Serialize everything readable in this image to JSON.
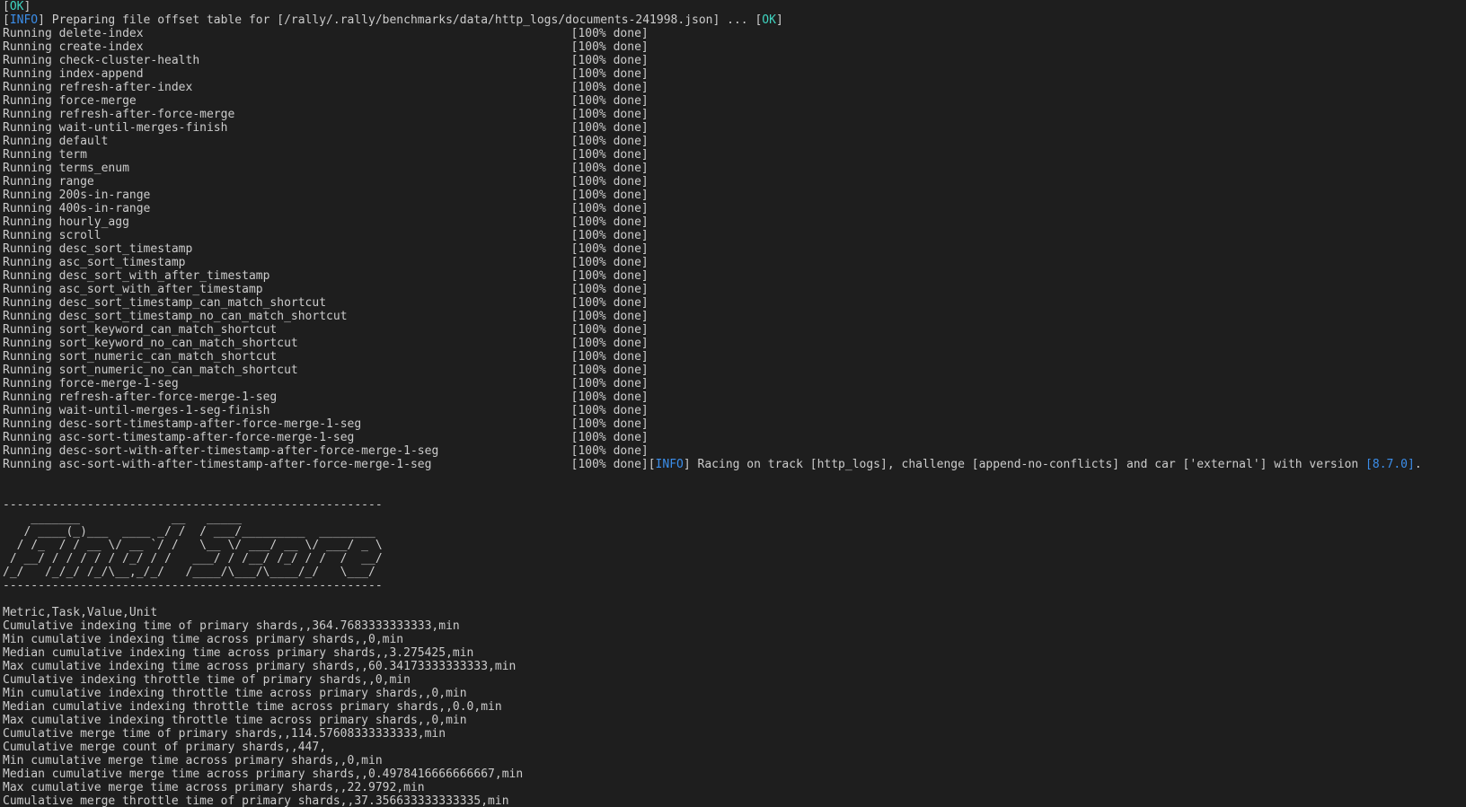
{
  "colors": {
    "background": "#1e1e1e",
    "text": "#cccccc",
    "status_ok": "#3fd4c0",
    "status_info": "#3b8eea",
    "version": "#3b8eea"
  },
  "header": {
    "ok_status": "OK",
    "info_status": "INFO",
    "offset_message": " Preparing file offset table for [/rally/.rally/benchmarks/data/http_logs/documents-241998.json] ... ",
    "offset_result": "OK"
  },
  "run": {
    "prefix": "Running ",
    "progress_label": "[100% done]",
    "tasks": [
      "delete-index",
      "create-index",
      "check-cluster-health",
      "index-append",
      "refresh-after-index",
      "force-merge",
      "refresh-after-force-merge",
      "wait-until-merges-finish",
      "default",
      "term",
      "terms_enum",
      "range",
      "200s-in-range",
      "400s-in-range",
      "hourly_agg",
      "scroll",
      "desc_sort_timestamp",
      "asc_sort_timestamp",
      "desc_sort_with_after_timestamp",
      "asc_sort_with_after_timestamp",
      "desc_sort_timestamp_can_match_shortcut",
      "desc_sort_timestamp_no_can_match_shortcut",
      "sort_keyword_can_match_shortcut",
      "sort_keyword_no_can_match_shortcut",
      "sort_numeric_can_match_shortcut",
      "sort_numeric_no_can_match_shortcut",
      "force-merge-1-seg",
      "refresh-after-force-merge-1-seg",
      "wait-until-merges-1-seg-finish",
      "desc-sort-timestamp-after-force-merge-1-seg",
      "asc-sort-timestamp-after-force-merge-1-seg",
      "desc-sort-with-after-timestamp-after-force-merge-1-seg",
      "asc-sort-with-after-timestamp-after-force-merge-1-seg"
    ]
  },
  "racing": {
    "info_status": "INFO",
    "message": " Racing on track [http_logs], challenge [append-no-conflicts] and car ['external'] with version ",
    "version": "[8.7.0]",
    "suffix": "."
  },
  "banner": {
    "separator": "------------------------------------------------------",
    "art": [
      "    _______             __   _____",
      "   / ____(_)___  ____ _/ /  / ___/_________  ________",
      "  / /_  / / __ \\/ __ `/ /   \\__ \\/ ___/ __ \\/ ___/ _ \\",
      " / __/ / / / / / /_/ / /   ___/ / /__/ /_/ / /  /  __/",
      "/_/   /_/_/ /_/\\__,_/_/   /____/\\___/\\____/_/   \\___/"
    ]
  },
  "results": {
    "header": "Metric,Task,Value,Unit",
    "rows": [
      "Cumulative indexing time of primary shards,,364.7683333333333,min",
      "Min cumulative indexing time across primary shards,,0,min",
      "Median cumulative indexing time across primary shards,,3.275425,min",
      "Max cumulative indexing time across primary shards,,60.34173333333333,min",
      "Cumulative indexing throttle time of primary shards,,0,min",
      "Min cumulative indexing throttle time across primary shards,,0,min",
      "Median cumulative indexing throttle time across primary shards,,0.0,min",
      "Max cumulative indexing throttle time across primary shards,,0,min",
      "Cumulative merge time of primary shards,,114.57608333333333,min",
      "Cumulative merge count of primary shards,,447,",
      "Min cumulative merge time across primary shards,,0,min",
      "Median cumulative merge time across primary shards,,0.4978416666666667,min",
      "Max cumulative merge time across primary shards,,22.9792,min",
      "Cumulative merge throttle time of primary shards,,37.356633333333335,min"
    ]
  }
}
